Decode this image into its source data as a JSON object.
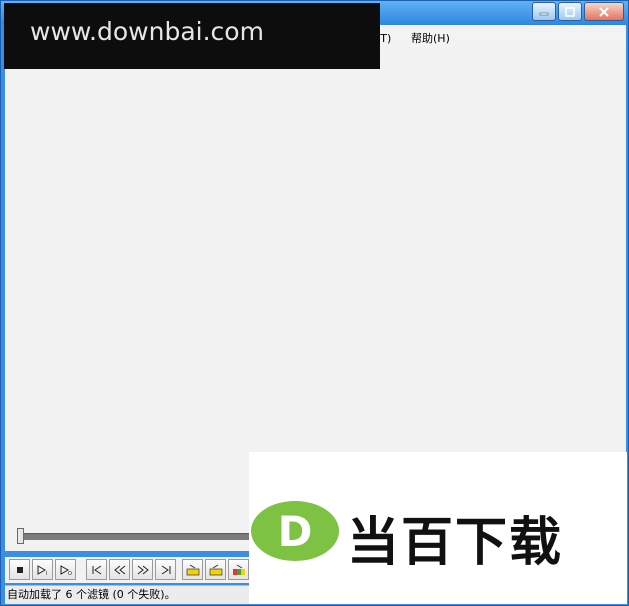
{
  "menu": {
    "tools_label": "具(T)",
    "help_label": "帮助(H)"
  },
  "watermark_top": {
    "text": "www.downbai.com"
  },
  "watermark_bottom": {
    "logo_letter": "D",
    "text": "当百下载"
  },
  "status": {
    "text": "自动加载了 6 个滤镜 (0 个失败)。"
  },
  "toolbar_icons": [
    "stop-icon",
    "play-input-icon",
    "play-output-icon",
    "go-to-start-icon",
    "rewind-icon",
    "fast-forward-icon",
    "go-to-end-icon",
    "mark-in-icon",
    "mark-out-icon",
    "scene-detect-icon"
  ],
  "colors": {
    "title_bar": "#2f86de",
    "client_bg": "#f2f2f2",
    "logo_green": "#7dc242"
  }
}
